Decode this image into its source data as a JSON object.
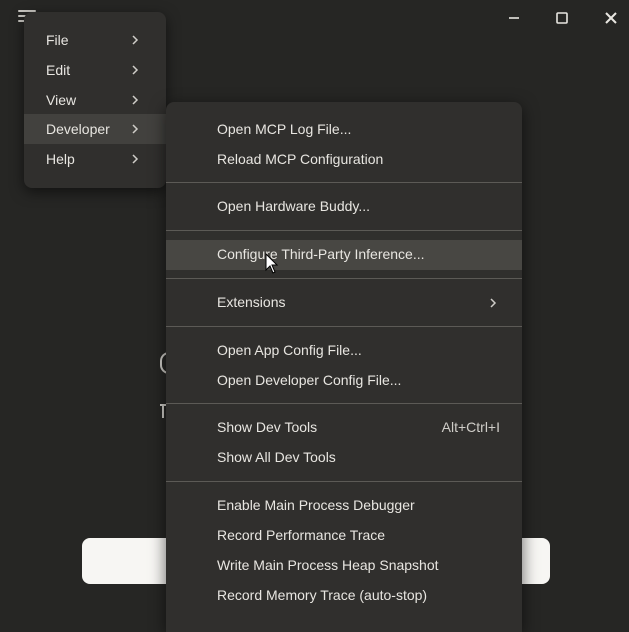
{
  "window": {
    "controls": {
      "minimize_icon": "minimize-icon",
      "maximize_icon": "maximize-icon",
      "close_icon": "close-icon"
    },
    "colors": {
      "background": "#262624",
      "menu": "#302f2d",
      "highlight": "#42413e"
    }
  },
  "menu": {
    "items": [
      {
        "label": "File"
      },
      {
        "label": "Edit"
      },
      {
        "label": "View"
      },
      {
        "label": "Developer"
      },
      {
        "label": "Help"
      }
    ]
  },
  "developer_submenu": {
    "items": [
      {
        "label": "Open MCP Log File..."
      },
      {
        "label": "Reload MCP Configuration"
      },
      {
        "label": "Open Hardware Buddy..."
      },
      {
        "label": "Configure Third-Party Inference..."
      },
      {
        "label": "Extensions"
      },
      {
        "label": "Open App Config File..."
      },
      {
        "label": "Open Developer Config File..."
      },
      {
        "label": "Show Dev Tools",
        "shortcut": "Alt+Ctrl+I"
      },
      {
        "label": "Show All Dev Tools"
      },
      {
        "label": "Enable Main Process Debugger"
      },
      {
        "label": "Record Performance Trace"
      },
      {
        "label": "Write Main Process Heap Snapshot"
      },
      {
        "label": "Record Memory Trace (auto-stop)"
      }
    ]
  }
}
